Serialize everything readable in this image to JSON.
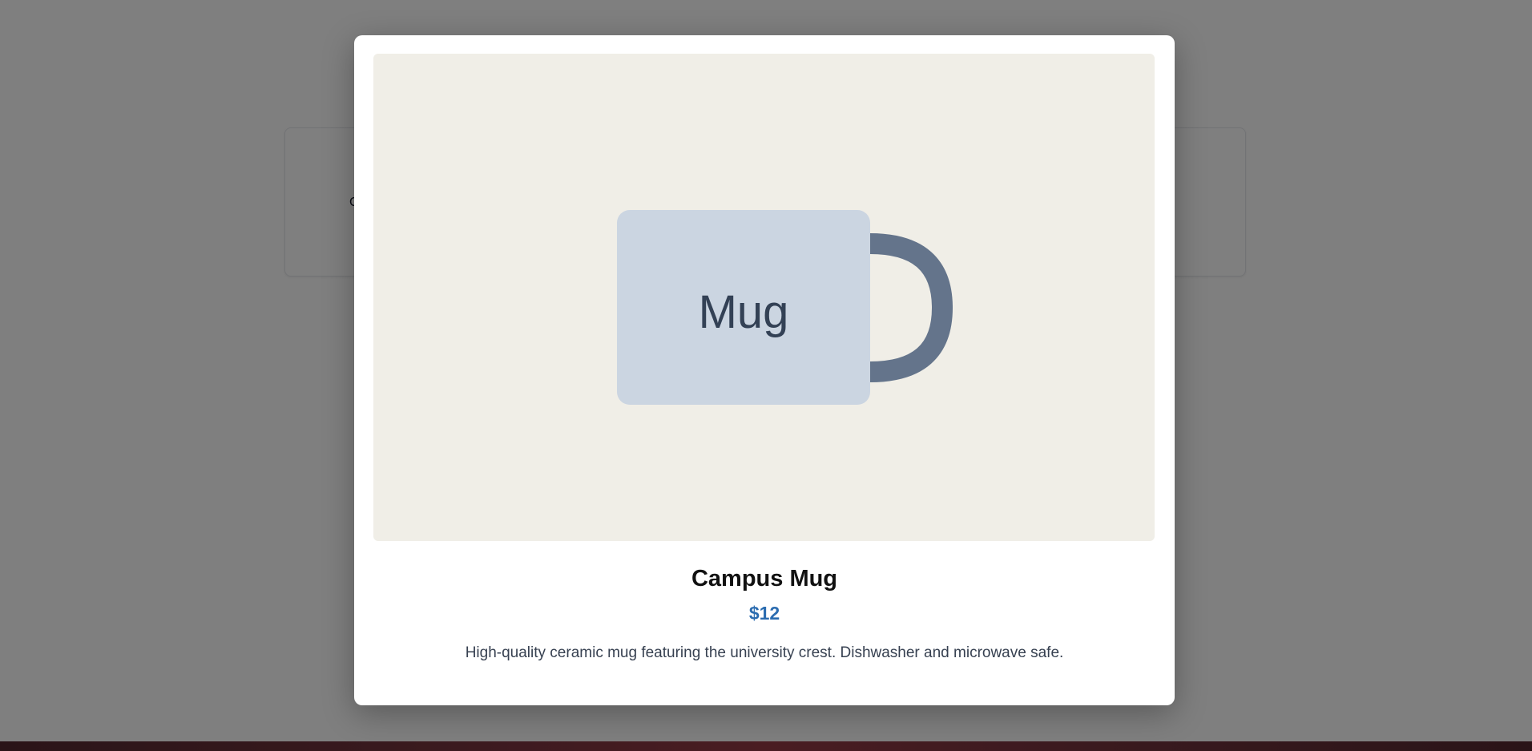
{
  "background": {
    "card_text": "C"
  },
  "modal": {
    "close_icon": "close-icon",
    "image": {
      "label": "Mug",
      "colors": {
        "background": "#f0eee7",
        "mug_body": "#cbd5e1",
        "mug_handle": "#64748b",
        "label_text": "#334155"
      }
    },
    "product": {
      "name": "Campus Mug",
      "price": "$12",
      "description": "High-quality ceramic mug featuring the university crest. Dishwasher and microwave safe."
    },
    "colors": {
      "price": "#2b6cb0"
    }
  }
}
